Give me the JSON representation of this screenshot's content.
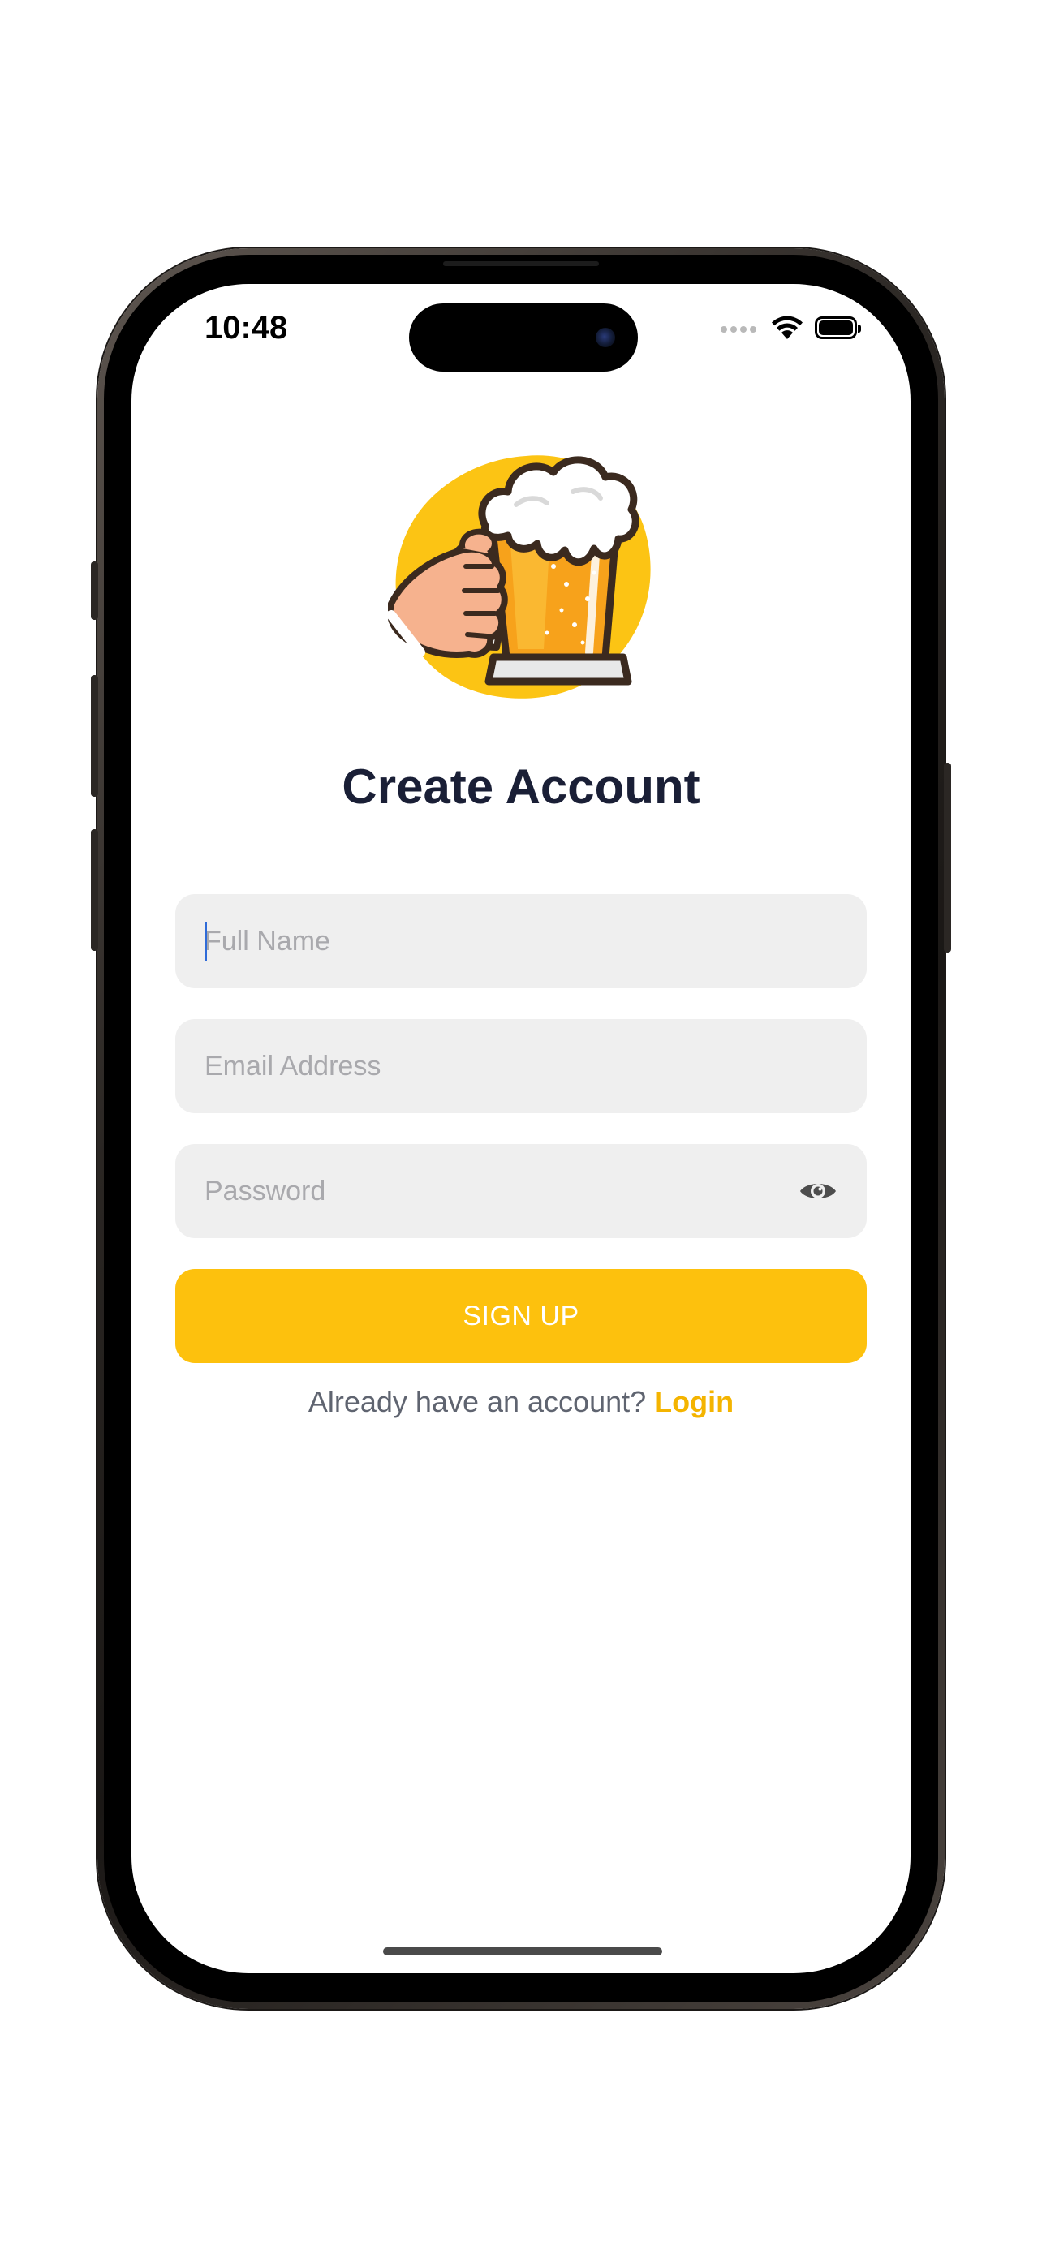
{
  "status_bar": {
    "time": "10:48"
  },
  "screen": {
    "title": "Create Account"
  },
  "form": {
    "full_name": {
      "value": "",
      "placeholder": "Full Name"
    },
    "email": {
      "value": "",
      "placeholder": "Email Address"
    },
    "password": {
      "value": "",
      "placeholder": "Password"
    },
    "signup_label": "SIGN UP"
  },
  "footer": {
    "prompt": "Already have an account?",
    "login_label": "Login"
  },
  "icons": {
    "logo": "beer-mug-logo-icon",
    "password_toggle": "eye-icon",
    "wifi": "wifi-icon",
    "battery": "battery-icon",
    "signal": "cellular-signal-icon"
  },
  "colors": {
    "accent": "#fdc10d",
    "login_link": "#f4b400",
    "title": "#1a1f36",
    "field_bg": "#efefef",
    "caret": "#2f6bd8"
  }
}
